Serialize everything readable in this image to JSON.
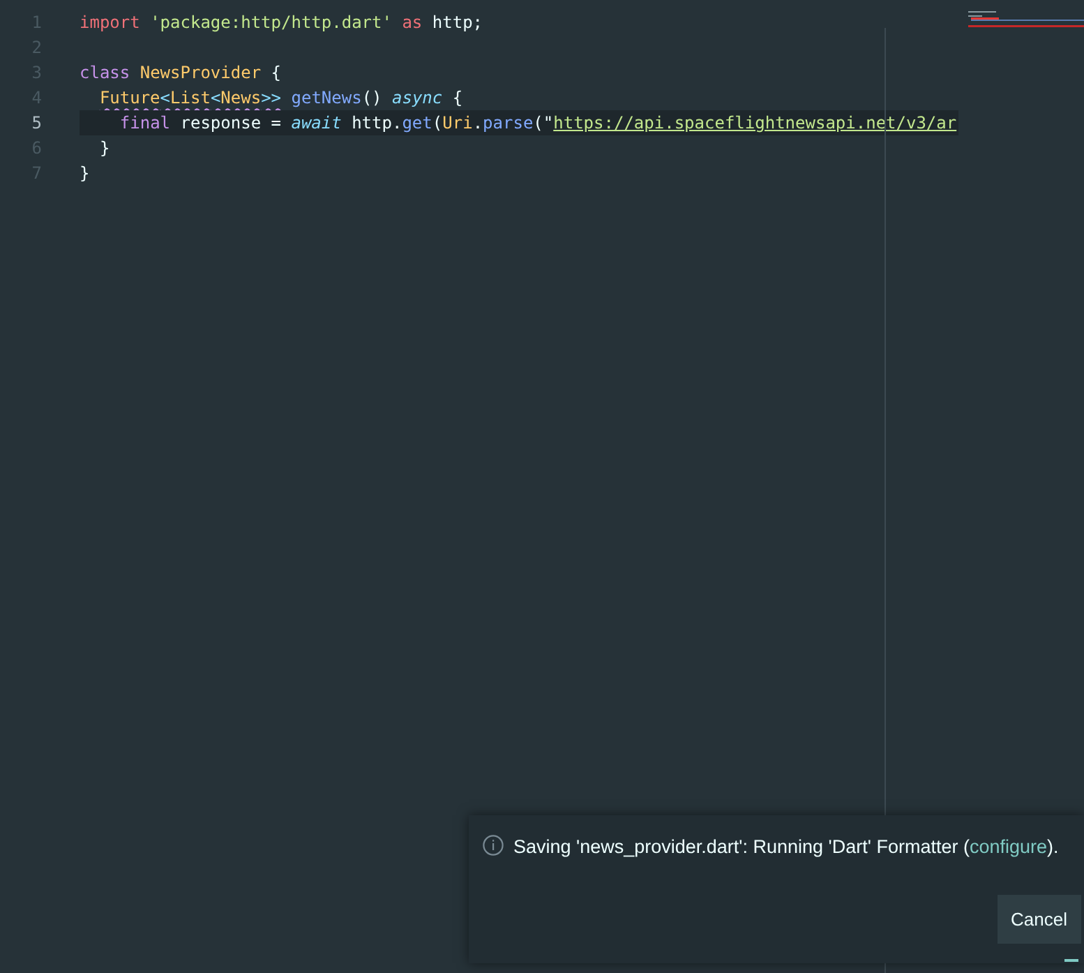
{
  "editor": {
    "lines": [
      {
        "number": "1",
        "active": false,
        "tokens": [
          {
            "kind": "keyword",
            "text": "import"
          },
          {
            "kind": "string",
            "text": " 'package:http/http.dart'"
          },
          {
            "kind": "keyword",
            "text": " as"
          },
          {
            "kind": "plain",
            "text": " http;"
          }
        ]
      },
      {
        "number": "2",
        "active": false
      },
      {
        "number": "3",
        "active": false,
        "tokens": [
          {
            "kind": "storage",
            "text": "class"
          },
          {
            "kind": "type",
            "text": " NewsProvider"
          },
          {
            "kind": "plain",
            "text": " {"
          }
        ],
        "children": [
          {
            "number": "4",
            "active": false,
            "tokens": [
              {
                "kind": "type",
                "text": "Future",
                "squiggle": true
              },
              {
                "kind": "op",
                "text": "<",
                "squiggle": true
              },
              {
                "kind": "type",
                "text": "List",
                "squiggle": true
              },
              {
                "kind": "op",
                "text": "<",
                "squiggle": true
              },
              {
                "kind": "type",
                "text": "News",
                "squiggle": true
              },
              {
                "kind": "op",
                "text": ">>",
                "squiggle": true
              },
              {
                "kind": "func",
                "text": " getNews"
              },
              {
                "kind": "plain",
                "text": "()"
              },
              {
                "kind": "modifier",
                "text": " async"
              },
              {
                "kind": "plain",
                "text": " {"
              }
            ],
            "children": [
              {
                "number": "5",
                "active": true,
                "tokens": [
                  {
                    "kind": "storage",
                    "text": "final"
                  },
                  {
                    "kind": "plain",
                    "text": " response = "
                  },
                  {
                    "kind": "modifier",
                    "text": "await"
                  },
                  {
                    "kind": "plain",
                    "text": " http."
                  },
                  {
                    "kind": "func",
                    "text": "get"
                  },
                  {
                    "kind": "plain",
                    "text": "("
                  },
                  {
                    "kind": "type",
                    "text": "Uri"
                  },
                  {
                    "kind": "plain",
                    "text": "."
                  },
                  {
                    "kind": "func",
                    "text": "parse"
                  },
                  {
                    "kind": "plain",
                    "text": "(\""
                  },
                  {
                    "kind": "link",
                    "text": "https://api.spaceflightnewsapi.net/v3/ar"
                  }
                ]
              }
            ]
          },
          {
            "number": "6",
            "active": false,
            "tokens": [
              {
                "kind": "plain",
                "text": "}"
              }
            ]
          }
        ]
      },
      {
        "number": "7",
        "active": false,
        "tokens": [
          {
            "kind": "plain",
            "text": "}"
          }
        ]
      }
    ]
  },
  "notification": {
    "message_before": "Saving 'news_provider.dart': Running 'Dart' Formatter (",
    "link": "configure",
    "message_after": ").",
    "buttons": [
      "Cancel"
    ]
  }
}
